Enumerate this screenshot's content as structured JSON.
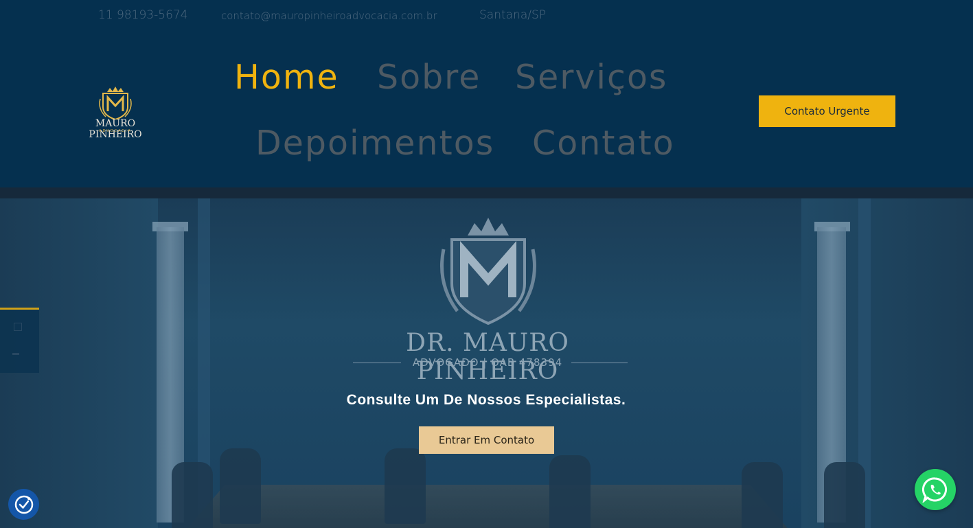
{
  "topbar": {
    "phone": "11 98193-5674",
    "email": "contato@mauropinheiroadvocacia.com.br",
    "location": "Santana/SP"
  },
  "logo": {
    "name": "MAURO PINHEIRO",
    "subtitle": "ADVOCACIA",
    "icon": "crest-m-icon"
  },
  "nav": {
    "items": [
      {
        "label": "Home",
        "active": true
      },
      {
        "label": "Sobre",
        "active": false
      },
      {
        "label": "Serviços",
        "active": false
      },
      {
        "label": "Depoimentos",
        "active": false
      },
      {
        "label": "Contato",
        "active": false
      }
    ]
  },
  "header_button": {
    "label": "Contato Urgente"
  },
  "hero": {
    "crest_name": "DR. MAURO PINHEIRO",
    "crest_subtitle": "ADVOGADO | OAB 478394",
    "title": "Consulte Um De Nossos Especialistas.",
    "button_label": "Entrar Em Contato"
  },
  "floating": {
    "accessibility_icon": "accessibility-check-icon",
    "whatsapp_icon": "whatsapp-icon"
  },
  "colors": {
    "header_bg": "#05304f",
    "accent_gold": "#efb30f",
    "button_beige": "#e9c995",
    "nav_inactive": "#4e5a63",
    "whatsapp_green": "#25d366",
    "a11y_blue": "#1456a8"
  }
}
